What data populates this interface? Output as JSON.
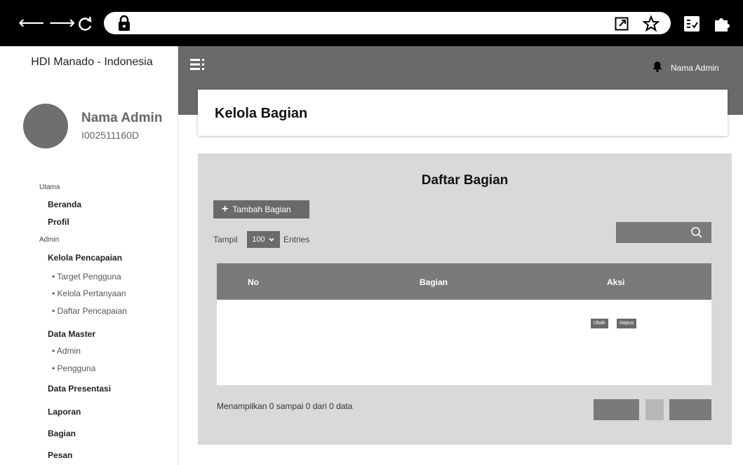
{
  "browser": {
    "back_icon": "arrow-left",
    "forward_icon": "arrow-right",
    "reload_icon": "reload",
    "lock_icon": "lock",
    "icons_right": [
      "open-external",
      "star",
      "reading-list",
      "puzzle-extension"
    ]
  },
  "sidebar": {
    "brand": "HDI Manado - Indonesia",
    "admin_name": "Nama Admin",
    "admin_id": "I002511160D",
    "sections": [
      {
        "label": "Utama"
      },
      {
        "label": "Admin"
      }
    ],
    "items": [
      "Beranda",
      "Profil",
      "Kelola Pencapaian",
      "Data Master",
      "Data Presentasi",
      "Laporan",
      "Bagian",
      "Pesan"
    ],
    "subitems": [
      "• Target Pengguna",
      "• Kelola Pertanyaan",
      "• Daftar Pencapaian",
      "• Admin",
      "• Pengguna"
    ]
  },
  "topbar": {
    "menu_icon": "hamburger",
    "bell_icon": "bell",
    "user_name": "Nama Admin"
  },
  "page": {
    "title": "Kelola Bagian"
  },
  "panel": {
    "title": "Daftar Bagian",
    "add_button": "Tambah Bagian",
    "show_label": "Tampil",
    "entries_value": "100",
    "entries_label": "Entries",
    "search_icon": "search",
    "table": {
      "columns": [
        "No",
        "Bagian",
        "Aksi"
      ],
      "actions": [
        "Ubah",
        "Hapus"
      ]
    },
    "info": "Menampilkan 0 sampai 0 dari 0 data"
  }
}
